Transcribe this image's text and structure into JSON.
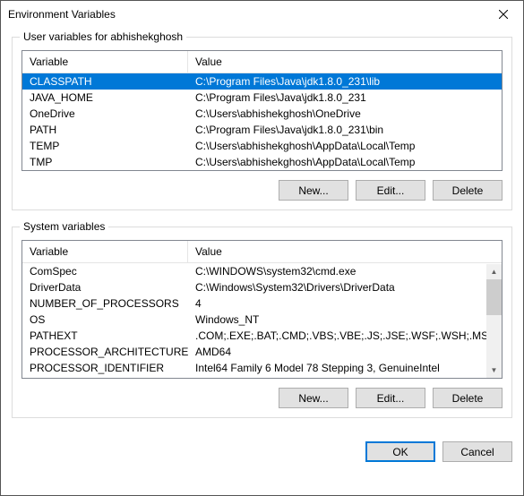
{
  "window": {
    "title": "Environment Variables"
  },
  "user_section": {
    "legend": "User variables for abhishekghosh",
    "headers": {
      "variable": "Variable",
      "value": "Value"
    },
    "rows": [
      {
        "name": "CLASSPATH",
        "value": "C:\\Program Files\\Java\\jdk1.8.0_231\\lib",
        "selected": true
      },
      {
        "name": "JAVA_HOME",
        "value": "C:\\Program Files\\Java\\jdk1.8.0_231",
        "selected": false
      },
      {
        "name": "OneDrive",
        "value": "C:\\Users\\abhishekghosh\\OneDrive",
        "selected": false
      },
      {
        "name": "PATH",
        "value": "C:\\Program Files\\Java\\jdk1.8.0_231\\bin",
        "selected": false
      },
      {
        "name": "TEMP",
        "value": "C:\\Users\\abhishekghosh\\AppData\\Local\\Temp",
        "selected": false
      },
      {
        "name": "TMP",
        "value": "C:\\Users\\abhishekghosh\\AppData\\Local\\Temp",
        "selected": false
      }
    ],
    "buttons": {
      "new": "New...",
      "edit": "Edit...",
      "delete": "Delete"
    }
  },
  "system_section": {
    "legend": "System variables",
    "headers": {
      "variable": "Variable",
      "value": "Value"
    },
    "rows": [
      {
        "name": "ComSpec",
        "value": "C:\\WINDOWS\\system32\\cmd.exe"
      },
      {
        "name": "DriverData",
        "value": "C:\\Windows\\System32\\Drivers\\DriverData"
      },
      {
        "name": "NUMBER_OF_PROCESSORS",
        "value": "4"
      },
      {
        "name": "OS",
        "value": "Windows_NT"
      },
      {
        "name": "PATHEXT",
        "value": ".COM;.EXE;.BAT;.CMD;.VBS;.VBE;.JS;.JSE;.WSF;.WSH;.MSC"
      },
      {
        "name": "PROCESSOR_ARCHITECTURE",
        "value": "AMD64"
      },
      {
        "name": "PROCESSOR_IDENTIFIER",
        "value": "Intel64 Family 6 Model 78 Stepping 3, GenuineIntel"
      }
    ],
    "buttons": {
      "new": "New...",
      "edit": "Edit...",
      "delete": "Delete"
    }
  },
  "footer": {
    "ok": "OK",
    "cancel": "Cancel"
  }
}
